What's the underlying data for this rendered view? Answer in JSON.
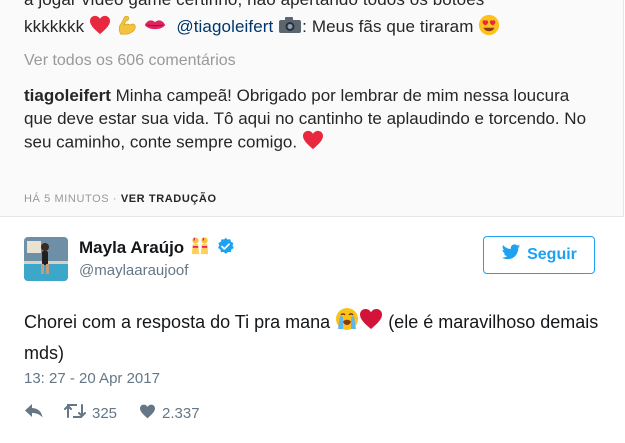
{
  "instagram": {
    "partial_line": "a jogar vídeo game certinho, não apertando todos os botões",
    "line1_prefix": "kkkkkkk",
    "mention": "@tiagoleifert",
    "line1_suffix": ": Meus fãs que tiraram",
    "view_all": "Ver todos os 606 comentários",
    "reply_author": "tiagoleifert",
    "reply_text": "Minha campeã! Obrigado por lembrar de mim nessa loucura que deve estar sua vida. Tô aqui no cantinho te aplaudindo e torcendo. No seu caminho, conte sempre comigo.",
    "time": "HÁ 5 MINUTOS",
    "separator": " · ",
    "translate": "VER TRADUÇÃO"
  },
  "tweet": {
    "name": "Mayla Araújo",
    "handle": "@maylaaraujoof",
    "follow_label": "Seguir",
    "text": "Chorei com a resposta do Ti pra mana",
    "text_after": " (ele é maravilhoso demais mds)",
    "timestamp": "13: 27 - 20 Apr 2017",
    "retweets": "325",
    "likes": "2.337"
  },
  "colors": {
    "twitter_blue": "#1da1f2",
    "verified": "#1da1f2",
    "heart_red": "#e0245e",
    "ig_bg": "#fafafa"
  },
  "icons": [
    "heart-emoji",
    "muscle-emoji",
    "kiss-emoji",
    "camera-emoji",
    "heart-eyes-emoji",
    "twin-dancers-emoji",
    "verified-badge-icon",
    "twitter-bird-icon",
    "crying-emoji",
    "reply-icon",
    "retweet-icon",
    "like-icon"
  ]
}
